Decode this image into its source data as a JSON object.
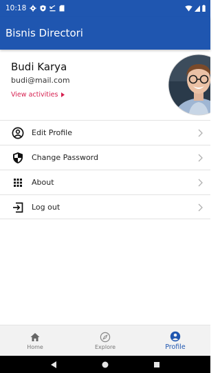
{
  "status_bar": {
    "time": "10:18",
    "icons": [
      "settings-icon",
      "shield-icon",
      "download-icon",
      "sd-card-icon",
      "wifi-icon",
      "signal-icon",
      "battery-icon"
    ]
  },
  "app_bar": {
    "title": "Bisnis Directori"
  },
  "profile": {
    "name": "Budi Karya",
    "email": "budi@mail.com",
    "view_activities": "View activities",
    "avatar": "user-photo"
  },
  "menu": {
    "items": [
      {
        "label": "Edit Profile",
        "icon": "account-circle-icon"
      },
      {
        "label": "Change Password",
        "icon": "security-shield-icon"
      },
      {
        "label": "About",
        "icon": "grid-icon"
      },
      {
        "label": "Log out",
        "icon": "logout-icon"
      }
    ]
  },
  "bottom_nav": {
    "tabs": [
      {
        "label": "Home",
        "icon": "home-icon"
      },
      {
        "label": "Explore",
        "icon": "compass-icon"
      },
      {
        "label": "Profile",
        "icon": "person-icon"
      }
    ],
    "active": "Profile"
  },
  "colors": {
    "primary": "#1f56b0",
    "accent": "#d61f4f",
    "divider": "#e2e2e2",
    "nav_bg": "#f2f2f2"
  }
}
